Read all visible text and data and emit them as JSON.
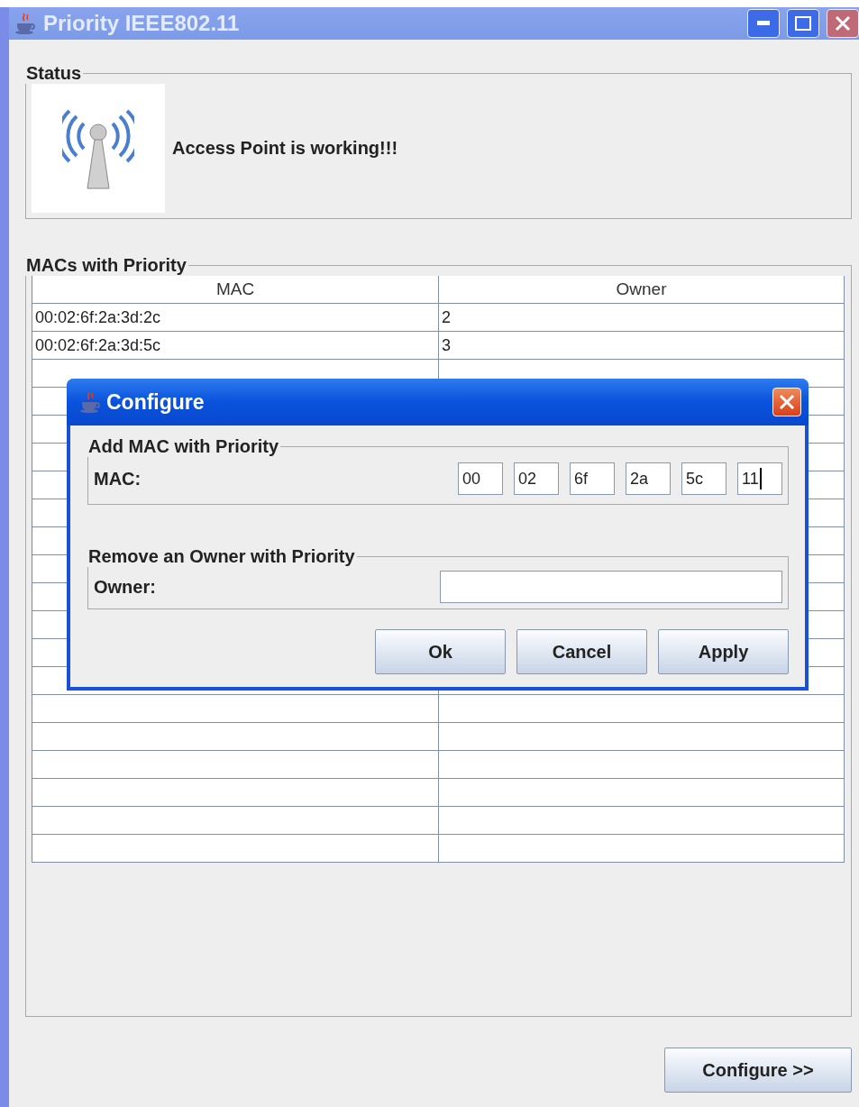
{
  "window": {
    "title": "Priority IEEE802.11"
  },
  "status": {
    "title": "Status",
    "message": "Access Point is working!!!"
  },
  "macs": {
    "title": "MACs with Priority",
    "columns": [
      "MAC",
      "Owner"
    ],
    "rows": [
      [
        "00:02:6f:2a:3d:2c",
        "2"
      ],
      [
        "00:02:6f:2a:3d:5c",
        "3"
      ]
    ]
  },
  "dialog": {
    "title": "Configure",
    "add_group": {
      "title": "Add MAC with Priority",
      "label": "MAC:",
      "fields": [
        {
          "value": "00",
          "focused": false
        },
        {
          "value": "02",
          "focused": false
        },
        {
          "value": "6f",
          "focused": false
        },
        {
          "value": "2a",
          "focused": false
        },
        {
          "value": "5c",
          "focused": false
        },
        {
          "value": "11",
          "focused": true
        }
      ]
    },
    "remove_group": {
      "title": "Remove an Owner with Priority",
      "label": "Owner:"
    },
    "buttons": [
      "Ok",
      "Cancel",
      "Apply"
    ]
  },
  "configure_button": "Configure >>"
}
